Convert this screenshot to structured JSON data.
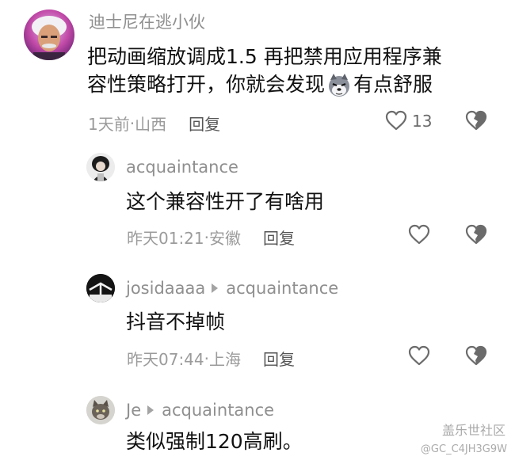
{
  "comments": [
    {
      "username": "迪士尼在逃小伙",
      "text_line1": "把动画缩放调成1.5  再把禁用应用程序兼",
      "text_line2_a": "容性策略打开，你就会发现",
      "emoji": "husky-emoji",
      "text_line2_b": "有点舒服",
      "time": "1天前",
      "location": "山西",
      "reply_label": "回复",
      "likes": "13"
    },
    {
      "username": "acquaintance",
      "text": "这个兼容性开了有啥用",
      "time": "昨天01:21",
      "location": "安徽",
      "reply_label": "回复"
    },
    {
      "username": "josidaaaa",
      "reply_to": "acquaintance",
      "text": "抖音不掉帧",
      "time": "昨天07:44",
      "location": "上海",
      "reply_label": "回复"
    },
    {
      "username": "Je",
      "reply_to": "acquaintance",
      "text": "类似强制120高刷。"
    }
  ],
  "separator": " · ",
  "watermark": {
    "logo": "盖乐世社区",
    "id": "@GC_C4JH3G9W"
  }
}
